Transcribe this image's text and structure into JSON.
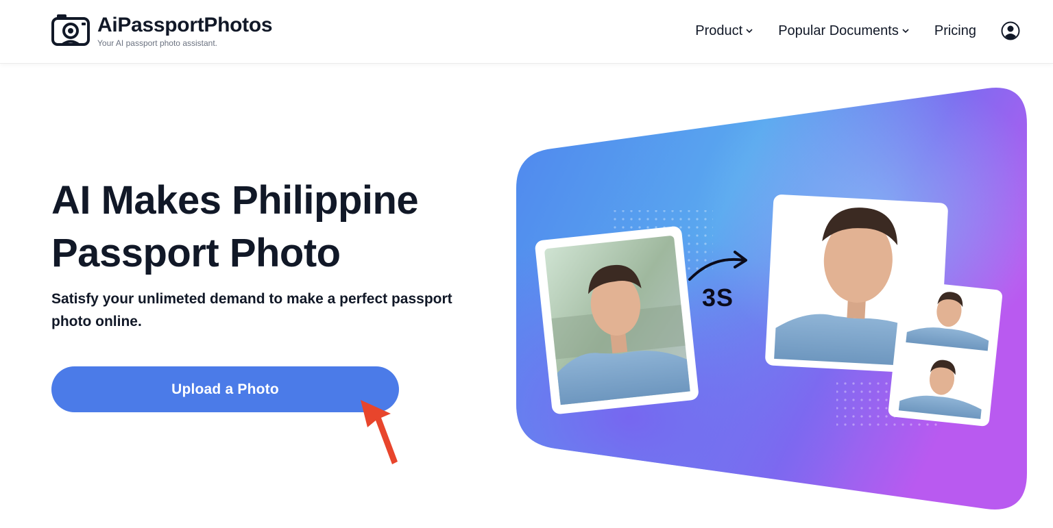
{
  "brand": {
    "name": "AiPassportPhotos",
    "tagline": "Your AI passport photo assistant."
  },
  "nav": {
    "items": [
      {
        "label": "Product",
        "has_dropdown": true
      },
      {
        "label": "Popular Documents",
        "has_dropdown": true
      },
      {
        "label": "Pricing",
        "has_dropdown": false
      }
    ],
    "account_icon": "user-circle-icon"
  },
  "hero": {
    "title_line1": "AI Makes Philippine",
    "title_line2": "Passport Photo",
    "subtitle": "Satisfy your unlimeted demand to make a perfect passport photo online.",
    "cta_label": "Upload a Photo",
    "process_label": "3S"
  },
  "colors": {
    "accent": "#4b7be8",
    "text": "#111827",
    "gradient_blue": "#5a8ef0",
    "gradient_purple": "#9b5cf0",
    "pointer_red": "#e8452c"
  }
}
